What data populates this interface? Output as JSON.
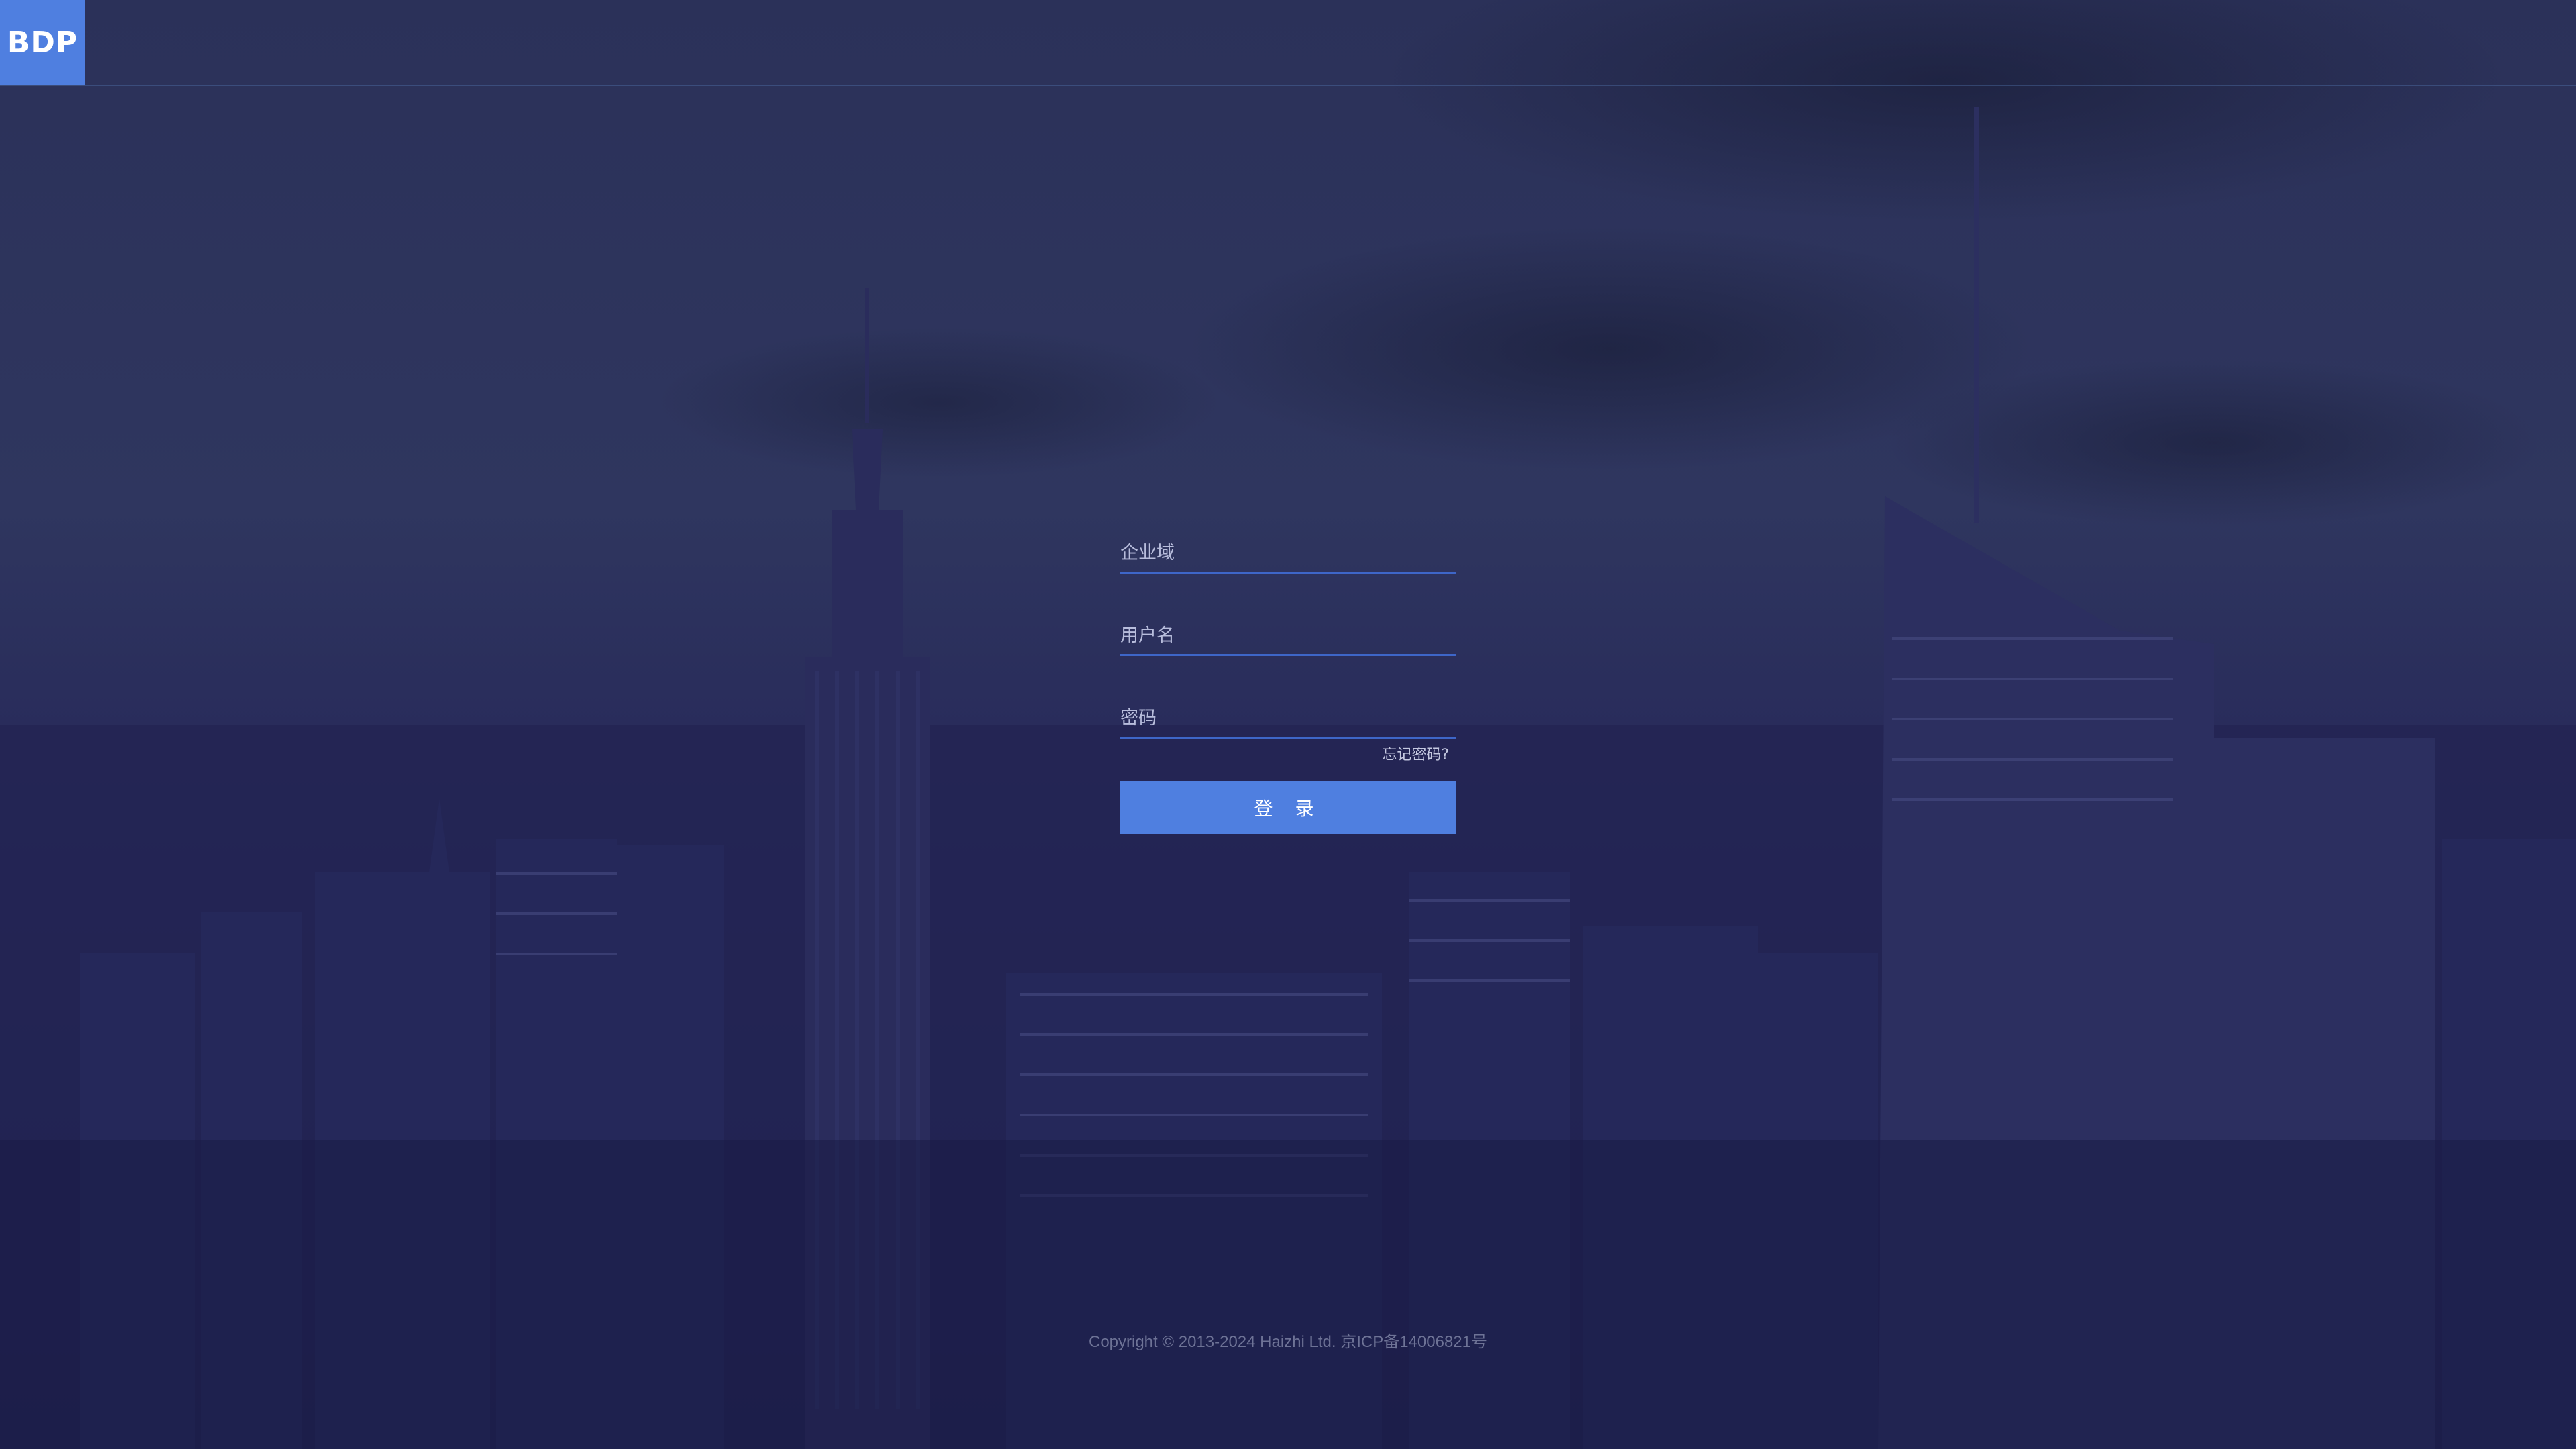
{
  "app": {
    "logo_text": "BDP",
    "brand_color": "#4f7fe0"
  },
  "login_form": {
    "domain_placeholder": "企业域",
    "username_placeholder": "用户名",
    "password_placeholder": "密码",
    "forgot_password_label": "忘记密码?",
    "login_button_label": "登 录"
  },
  "footer": {
    "copyright": "Copyright © 2013-2024 Haizhi Ltd. 京ICP备14006821号"
  }
}
